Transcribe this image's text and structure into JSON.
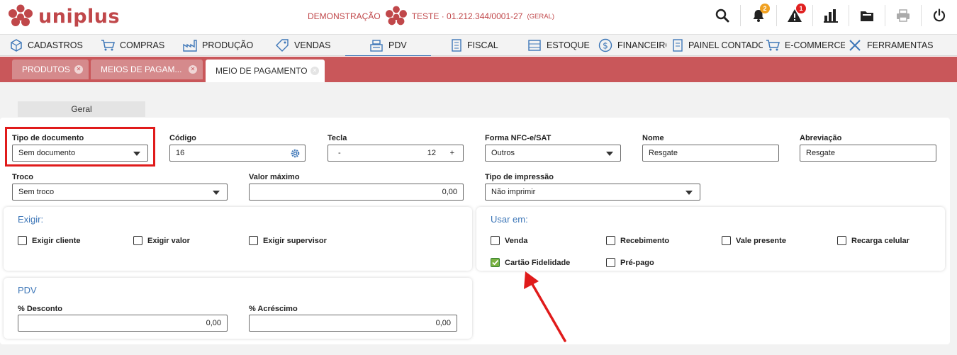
{
  "app": {
    "logo_text": "uniplus",
    "company_prefix": "DEMONSTRAÇÃO",
    "company_name": "TESTE · 01.212.344/0001-27",
    "company_scope": "(GERAL)"
  },
  "header_icons": [
    {
      "name": "search-icon"
    },
    {
      "name": "bell-icon",
      "badge": "2",
      "badge_color": "#f0a020"
    },
    {
      "name": "alert-icon",
      "badge": "1",
      "badge_color": "#e02020"
    },
    {
      "name": "chart-icon"
    },
    {
      "name": "folder-icon"
    },
    {
      "name": "print-icon"
    },
    {
      "name": "power-icon"
    }
  ],
  "nav": [
    {
      "label": "CADASTROS",
      "icon": "cube-icon"
    },
    {
      "label": "COMPRAS",
      "icon": "cart-icon"
    },
    {
      "label": "PRODUÇÃO",
      "icon": "factory-icon"
    },
    {
      "label": "VENDAS",
      "icon": "tag-icon"
    },
    {
      "label": "PDV",
      "icon": "register-icon",
      "active": true
    },
    {
      "label": "FISCAL",
      "icon": "document-icon"
    },
    {
      "label": "ESTOQUE",
      "icon": "warehouse-icon"
    },
    {
      "label": "FINANCEIRO",
      "icon": "dollar-icon"
    },
    {
      "label": "PAINEL CONTADOR",
      "icon": "report-icon"
    },
    {
      "label": "E-COMMERCE",
      "icon": "cart-icon"
    },
    {
      "label": "FERRAMENTAS",
      "icon": "tools-icon"
    }
  ],
  "tabs": [
    {
      "label": "PRODUTOS"
    },
    {
      "label": "MEIOS DE PAGAM..."
    },
    {
      "label": "MEIO DE PAGAMENTO",
      "active": true
    }
  ],
  "form": {
    "subtab": "Geral",
    "tipo_documento": {
      "label": "Tipo de documento",
      "value": "Sem documento"
    },
    "codigo": {
      "label": "Código",
      "value": "16"
    },
    "tecla": {
      "label": "Tecla",
      "minus": "-",
      "value": "12",
      "plus": "+"
    },
    "forma_nfce": {
      "label": "Forma NFC-e/SAT",
      "value": "Outros"
    },
    "nome": {
      "label": "Nome",
      "value": "Resgate"
    },
    "abreviacao": {
      "label": "Abreviação",
      "value": "Resgate"
    },
    "troco": {
      "label": "Troco",
      "value": "Sem troco"
    },
    "valor_maximo": {
      "label": "Valor máximo",
      "value": "0,00"
    },
    "tipo_impressao": {
      "label": "Tipo de impressão",
      "value": "Não imprimir"
    }
  },
  "exigir": {
    "title": "Exigir:",
    "items": [
      {
        "label": "Exigir cliente",
        "checked": false
      },
      {
        "label": "Exigir valor",
        "checked": false
      },
      {
        "label": "Exigir supervisor",
        "checked": false
      }
    ]
  },
  "usar_em": {
    "title": "Usar em:",
    "items": [
      {
        "label": "Venda",
        "checked": false
      },
      {
        "label": "Recebimento",
        "checked": false
      },
      {
        "label": "Vale presente",
        "checked": false
      },
      {
        "label": "Recarga celular",
        "checked": false
      },
      {
        "label": "Cartão Fidelidade",
        "checked": true
      },
      {
        "label": "Pré-pago",
        "checked": false
      }
    ]
  },
  "pdv": {
    "title": "PDV",
    "desconto": {
      "label": "% Desconto",
      "value": "0,00"
    },
    "acrescimo": {
      "label": "% Acréscimo",
      "value": "0,00"
    }
  },
  "colors": {
    "brand": "#c0474a",
    "tabstrip": "#c9575a",
    "accent": "#3e77b8",
    "highlight": "#e01b1b"
  }
}
